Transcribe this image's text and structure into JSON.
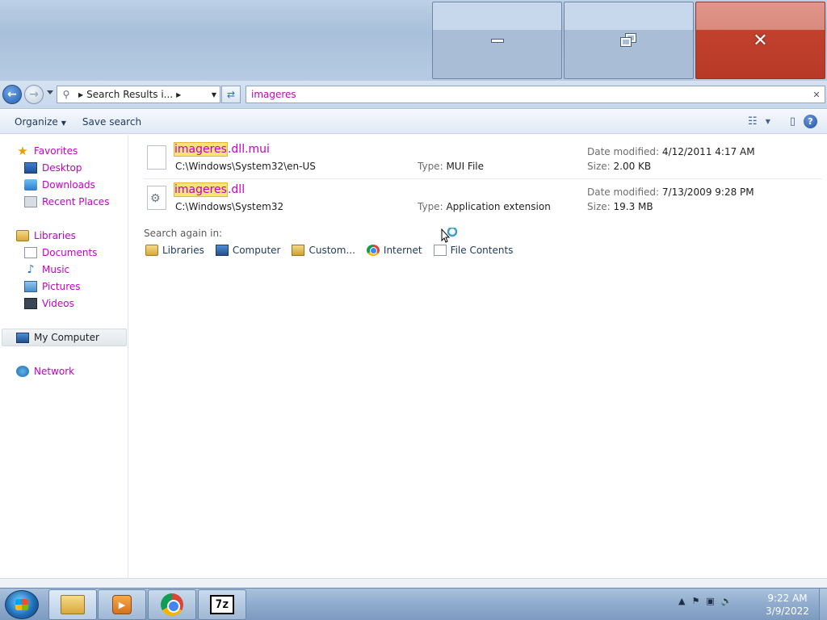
{
  "window": {
    "controls": {
      "minimize": "minimize",
      "restore": "restore",
      "close": "close"
    }
  },
  "address": {
    "breadcrumb": "Search Results i...",
    "search_query": "imageres"
  },
  "commands": {
    "organize": "Organize",
    "save_search": "Save search"
  },
  "nav": {
    "favorites": "Favorites",
    "desktop": "Desktop",
    "downloads": "Downloads",
    "recent_places": "Recent Places",
    "libraries": "Libraries",
    "documents": "Documents",
    "music": "Music",
    "pictures": "Pictures",
    "videos": "Videos",
    "my_computer": "My Computer",
    "network": "Network"
  },
  "results": [
    {
      "name_highlight": "imageres",
      "name_rest": ".dll.mui",
      "path": "C:\\Windows\\System32\\en-US",
      "type_label": "Type:",
      "type": "MUI File",
      "date_label": "Date modified:",
      "date": "4/12/2011 4:17 AM",
      "size_label": "Size:",
      "size": "2.00 KB",
      "icon": "file-icon"
    },
    {
      "name_highlight": "imageres",
      "name_rest": ".dll",
      "path": "C:\\Windows\\System32",
      "type_label": "Type:",
      "type": "Application extension",
      "date_label": "Date modified:",
      "date": "7/13/2009 9:28 PM",
      "size_label": "Size:",
      "size": "19.3 MB",
      "icon": "dll-gear-icon"
    }
  ],
  "search_again": {
    "label": "Search again in:",
    "links": [
      "Libraries",
      "Computer",
      "Custom...",
      "Internet",
      "File Contents"
    ]
  },
  "taskbar": {
    "apps": [
      "explorer",
      "media-player",
      "chrome",
      "7-zip"
    ],
    "seven_zip_label": "7z",
    "clock_time": "9:22 AM",
    "clock_date": "3/9/2022"
  },
  "colors": {
    "link_magenta": "#c400c4",
    "highlight": "#f8e27a",
    "close_red": "#c1412d"
  }
}
